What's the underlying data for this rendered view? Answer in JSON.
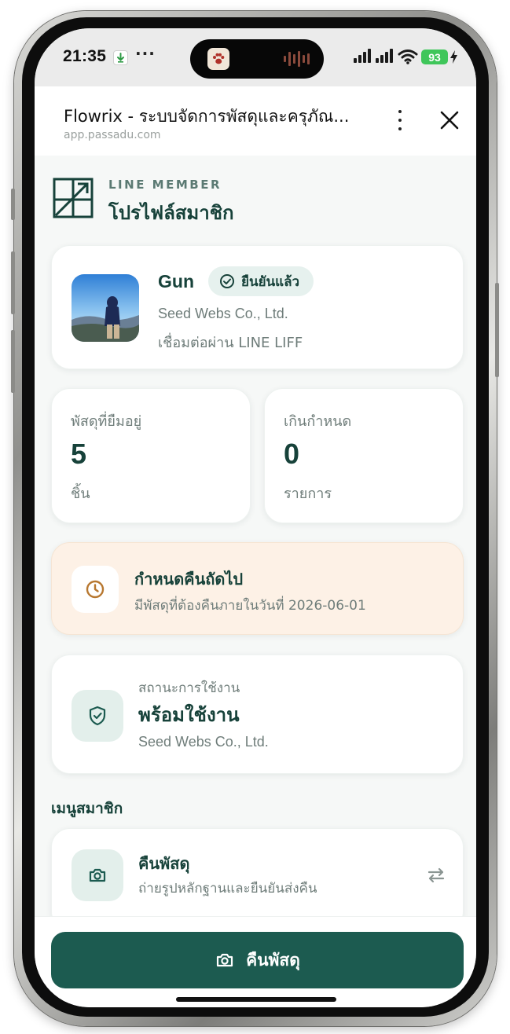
{
  "status_bar": {
    "time": "21:35",
    "more": "···",
    "battery": "93"
  },
  "browser": {
    "title": "Flowrix - ระบบจัดการพัสดุและครุภัณ...",
    "url": "app.passadu.com"
  },
  "header": {
    "kicker": "LINE MEMBER",
    "title": "โปรไฟล์สมาชิก"
  },
  "profile": {
    "name": "Gun",
    "verified_label": "ยืนยันแล้ว",
    "company": "Seed Webs Co., Ltd.",
    "connection": "เชื่อมต่อผ่าน LINE LIFF"
  },
  "stats": [
    {
      "label": "พัสดุที่ยืมอยู่",
      "value": "5",
      "unit": "ชิ้น"
    },
    {
      "label": "เกินกำหนด",
      "value": "0",
      "unit": "รายการ"
    }
  ],
  "due": {
    "title": "กำหนดคืนถัดไป",
    "subtitle": "มีพัสดุที่ต้องคืนภายในวันที่ 2026-06-01"
  },
  "usage_status": {
    "label": "สถานะการใช้งาน",
    "value": "พร้อมใช้งาน",
    "company": "Seed Webs Co., Ltd."
  },
  "menu": {
    "heading": "เมนูสมาชิก",
    "items": [
      {
        "title": "คืนพัสดุ",
        "subtitle": "ถ่ายรูปหลักฐานและยืนยันส่งคืน",
        "icon": "camera-icon"
      }
    ]
  },
  "bottom": {
    "button_label": "คืนพัสดุ"
  },
  "colors": {
    "accent": "#1c5b50",
    "accent_text": "#17423a",
    "due_bg": "#fdf1e6",
    "battery": "#3fc65a"
  }
}
